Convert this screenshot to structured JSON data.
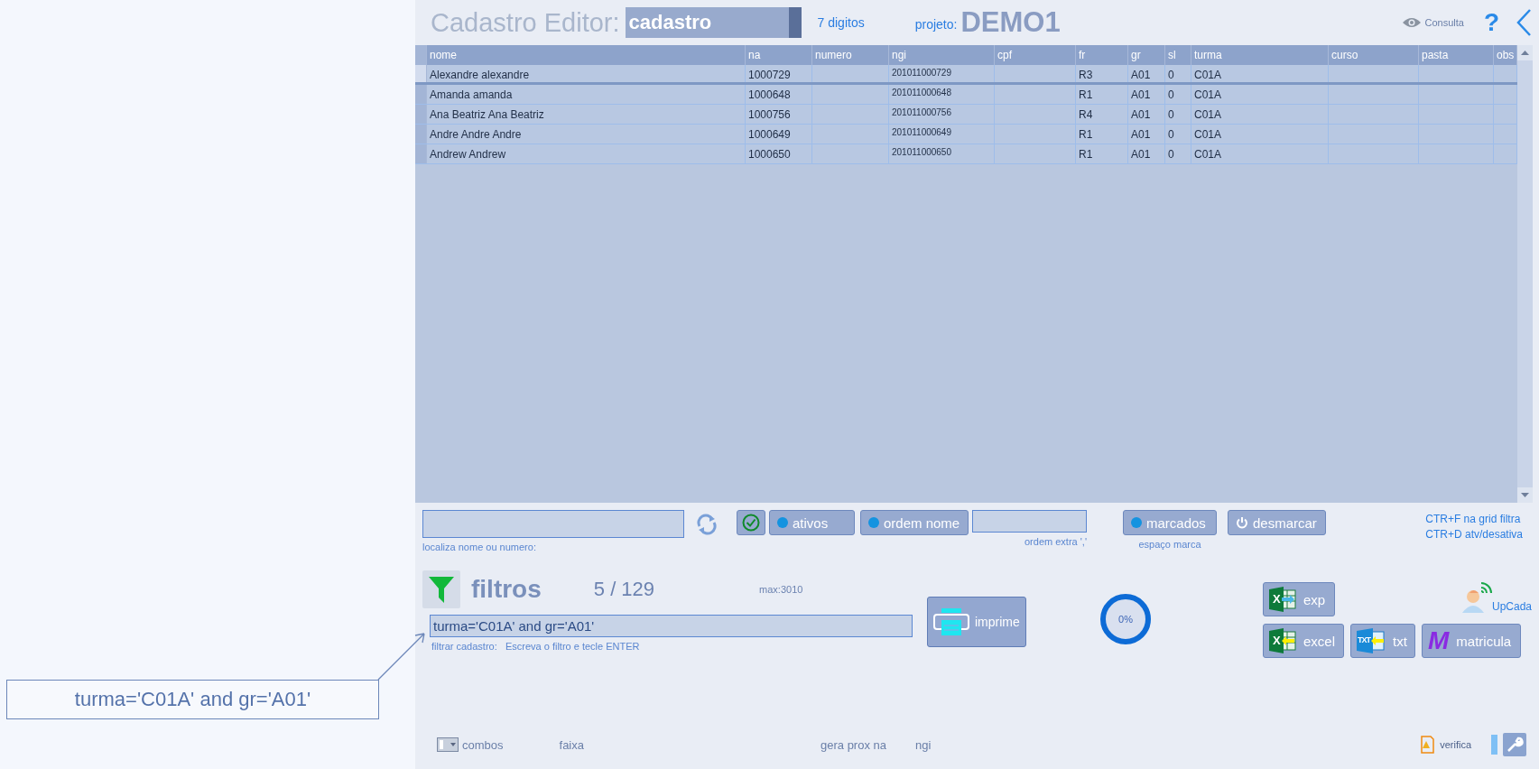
{
  "header": {
    "title": "Cadastro Editor:",
    "table_select": "cadastro",
    "digits": "7 digitos",
    "project_label": "projeto:",
    "project": "DEMO1",
    "view_mode": "Consulta",
    "help": "?"
  },
  "grid": {
    "columns": [
      "nome",
      "na",
      "numero",
      "ngi",
      "cpf",
      "fr",
      "gr",
      "sl",
      "turma",
      "curso",
      "pasta",
      "obs"
    ],
    "rows": [
      {
        "selected": true,
        "cells": [
          "Alexandre alexandre",
          "1000729",
          "",
          "201011000729",
          "",
          "R3",
          "A01",
          "0",
          "C01A",
          "",
          "",
          ""
        ]
      },
      {
        "selected": false,
        "cells": [
          "Amanda amanda",
          "1000648",
          "",
          "201011000648",
          "",
          "R1",
          "A01",
          "0",
          "C01A",
          "",
          "",
          ""
        ]
      },
      {
        "selected": false,
        "cells": [
          "Ana Beatriz Ana Beatriz",
          "1000756",
          "",
          "201011000756",
          "",
          "R4",
          "A01",
          "0",
          "C01A",
          "",
          "",
          ""
        ]
      },
      {
        "selected": false,
        "cells": [
          "Andre Andre Andre",
          "1000649",
          "",
          "201011000649",
          "",
          "R1",
          "A01",
          "0",
          "C01A",
          "",
          "",
          ""
        ]
      },
      {
        "selected": false,
        "cells": [
          "Andrew Andrew",
          "1000650",
          "",
          "201011000650",
          "",
          "R1",
          "A01",
          "0",
          "C01A",
          "",
          "",
          ""
        ]
      }
    ]
  },
  "search": {
    "hint": "localiza nome ou numero:"
  },
  "toggles": [
    {
      "label": "ativos",
      "on": true
    },
    {
      "label": "ordem nome",
      "on": true
    }
  ],
  "extra_order": {
    "hint": "ordem extra ','"
  },
  "marked": {
    "label": "marcados",
    "on": true,
    "hint": "espaço marca"
  },
  "unmark": "desmarcar",
  "shortcuts": [
    "CTR+F na grid filtra",
    "CTR+D atv/desativa"
  ],
  "filters": {
    "title": "filtros",
    "count": "5 / 129",
    "max": "max:3010",
    "value": "turma='C01A' and gr='A01'",
    "hint_label": "filtrar cadastro:",
    "hint": "Escreva o filtro e tecle ENTER"
  },
  "print_button": "imprime",
  "progress": "0%",
  "actions": [
    {
      "kind": "excel-export",
      "glyph": "X",
      "label": "exp"
    },
    {
      "kind": "excel-import",
      "glyph": "X",
      "label": "excel"
    },
    {
      "kind": "txt-import",
      "glyph": "TXT",
      "label": "txt"
    },
    {
      "kind": "letter",
      "glyph": "M",
      "label": "matricula"
    }
  ],
  "upload": "UpCada",
  "footer": {
    "combos": "combos",
    "range": "faixa",
    "next_label": "gera prox na",
    "next_field": "ngi",
    "verify": "verifica"
  },
  "callout": "turma='C01A' and gr='A01'"
}
